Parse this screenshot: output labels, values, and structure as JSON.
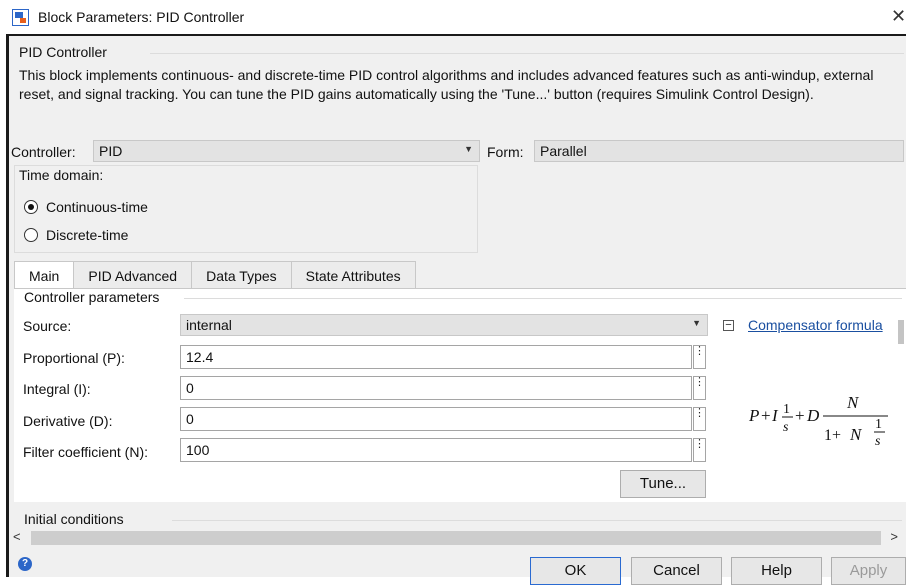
{
  "window": {
    "title": "Block Parameters: PID Controller"
  },
  "block": {
    "name": "PID Controller",
    "description": "This block implements continuous- and discrete-time PID control algorithms and includes advanced features such as anti-windup, external reset, and signal tracking. You can tune the PID gains automatically using the 'Tune...' button (requires Simulink Control Design)."
  },
  "controller": {
    "label": "Controller:",
    "value": "PID"
  },
  "form": {
    "label": "Form:",
    "value": "Parallel"
  },
  "time_domain": {
    "legend": "Time domain:",
    "options": [
      {
        "label": "Continuous-time",
        "checked": true
      },
      {
        "label": "Discrete-time",
        "checked": false
      }
    ]
  },
  "tabs": [
    {
      "label": "Main",
      "active": true
    },
    {
      "label": "PID Advanced",
      "active": false
    },
    {
      "label": "Data Types",
      "active": false
    },
    {
      "label": "State Attributes",
      "active": false
    }
  ],
  "controller_parameters": {
    "legend": "Controller parameters",
    "source": {
      "label": "Source:",
      "value": "internal"
    },
    "fields": [
      {
        "label": "Proportional (P):",
        "value": "12.4"
      },
      {
        "label": "Integral (I):",
        "value": "0"
      },
      {
        "label": "Derivative (D):",
        "value": "0"
      },
      {
        "label": "Filter coefficient (N):",
        "value": "100"
      }
    ],
    "compensator_link": "Compensator formula",
    "formula": {
      "P": "P",
      "I": "I",
      "D": "D",
      "N": "N",
      "s": "s",
      "one": "1",
      "one_plus": "1+",
      "plus": "+"
    },
    "tune_label": "Tune..."
  },
  "initial_conditions": {
    "legend": "Initial conditions"
  },
  "buttons": {
    "ok": "OK",
    "cancel": "Cancel",
    "help": "Help",
    "apply": "Apply"
  },
  "icons": [
    "simulink-block-icon",
    "close-icon",
    "dropdown-arrow-icon",
    "parameter-menu-icon",
    "collapse-icon",
    "scroll-left-icon",
    "scroll-right-icon",
    "help-icon"
  ]
}
